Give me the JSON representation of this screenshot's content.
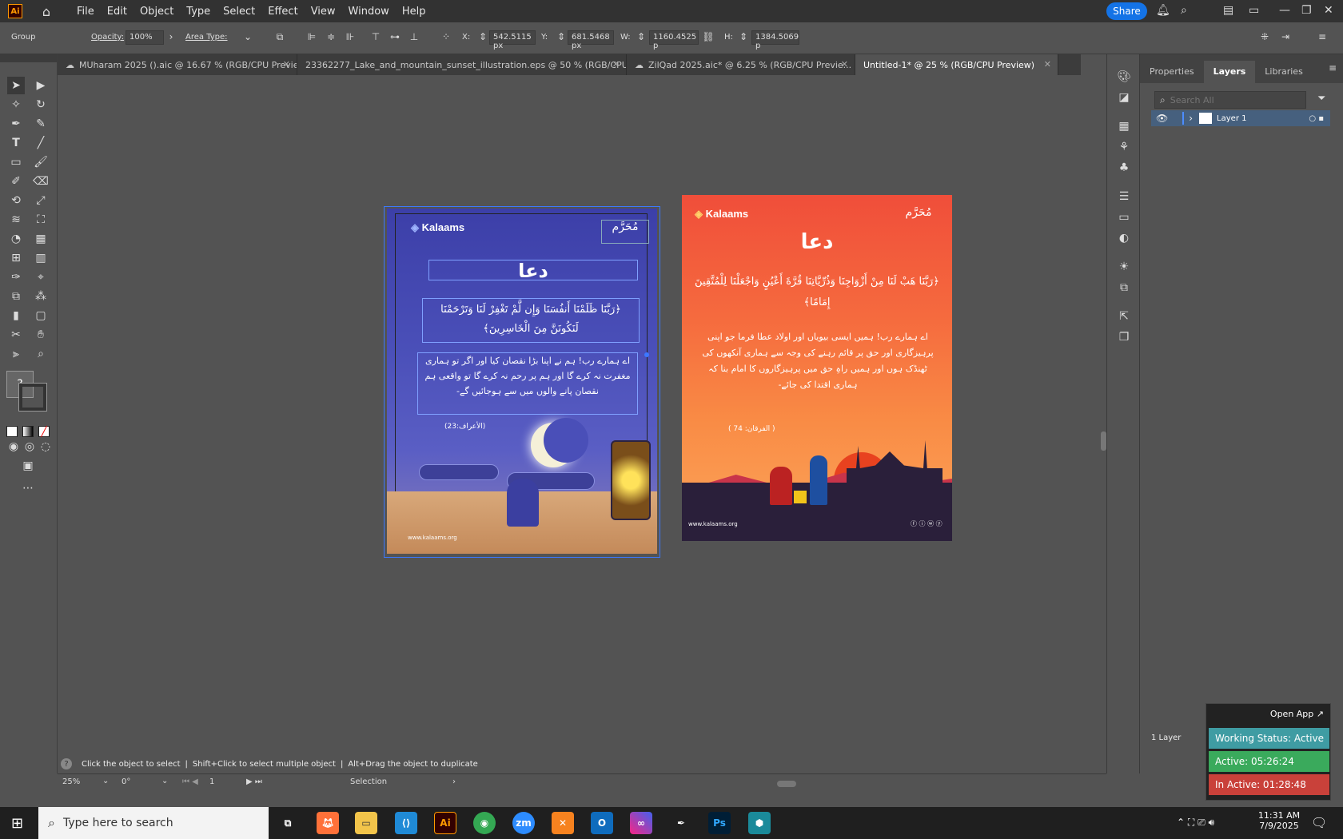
{
  "menubar": {
    "logo": "Ai",
    "items": [
      "File",
      "Edit",
      "Object",
      "Type",
      "Select",
      "Effect",
      "View",
      "Window",
      "Help"
    ],
    "share_label": "Share"
  },
  "controlbar": {
    "selection_type": "Group",
    "opacity_label": "Opacity:",
    "opacity_value": "100%",
    "area_type_label": "Area Type:",
    "x_label": "X:",
    "x_value": "542.5115 px",
    "y_label": "Y:",
    "y_value": "681.5468 px",
    "w_label": "W:",
    "w_value": "1160.4525 p",
    "h_label": "H:",
    "h_value": "1384.5069 p"
  },
  "tabs": [
    {
      "label": "MUharam 2025 ().aic @ 16.67 % (RGB/CPU Previe...",
      "active": false
    },
    {
      "label": "23362277_Lake_and_mountain_sunset_illustration.eps @ 50 % (RGB/CPU...",
      "active": false
    },
    {
      "label": "ZilQad 2025.aic* @ 6.25 % (RGB/CPU Previe...",
      "active": false
    },
    {
      "label": "Untitled-1* @ 25 % (RGB/CPU Preview)",
      "active": true
    }
  ],
  "panel": {
    "tabs": [
      "Properties",
      "Layers",
      "Libraries"
    ],
    "active_tab": "Layers",
    "search_placeholder": "Search All",
    "layer_name": "Layer 1",
    "layer_count": "1 Layer"
  },
  "artboard1": {
    "brand": "Kalaams",
    "title": "دعا",
    "arabic": "﴿رَبَّنَا ظَلَمْنَا أَنفُسَنَا وَإِن لَّمْ تَغْفِرْ لَنَا وَتَرْحَمْنَا لَنَكُونَنَّ مِنَ الْخَاسِرِينَ﴾",
    "urdu": "اے ہمارے رب! ہم نے اپنا بڑا نقصان کیا اور اگر تو ہماری مغفرت نہ کرے گا اور ہم پر رحم نہ کرے گا تو واقعی ہم نقصان پانے والوں میں سے ہوجائیں گے-",
    "reference": "(الأعراف:23)",
    "website": "www.kalaams.org"
  },
  "artboard2": {
    "brand": "Kalaams",
    "title": "دعا",
    "arabic": "﴿رَبَّنَا هَبْ لَنَا مِنْ أَزْوَاجِنَا وَذُرِّيَّاتِنَا قُرَّةَ أَعْيُنٍ وَاجْعَلْنَا لِلْمُتَّقِينَ إِمَامًا﴾",
    "urdu": "اے ہمارے رب! ہمیں ایسی بیویاں اور اولاد عطا فرما جو اپنی پرہیزگاری اور حق پر قائم رہنے کی وجہ سے ہماری آنکھوں کی ٹھنڈک ہوں اور ہمیں راہِ حق میں پرہیزگاروں کا امام بنا کہ ہماری اقتدا کی جائے-",
    "reference": "( الفرقان: 74 )",
    "website": "www.kalaams.org"
  },
  "hint": {
    "text1": "Click the object to select",
    "text2": "Shift+Click to select multiple object",
    "text3": "Alt+Drag the object to duplicate"
  },
  "statusbar": {
    "zoom": "25%",
    "rotation": "0°",
    "artboard_num": "1",
    "tool": "Selection"
  },
  "widget": {
    "open_app": "Open App",
    "working_status": "Working Status: Active",
    "active": "Active: 05:26:24",
    "inactive": "In Active: 01:28:48",
    "colors": {
      "status": "#3f9ca3",
      "active": "#3aaa5c",
      "inactive": "#c9413a"
    }
  },
  "taskbar": {
    "search_placeholder": "Type here to search",
    "time": "11:31 AM",
    "date": "7/9/2025"
  }
}
